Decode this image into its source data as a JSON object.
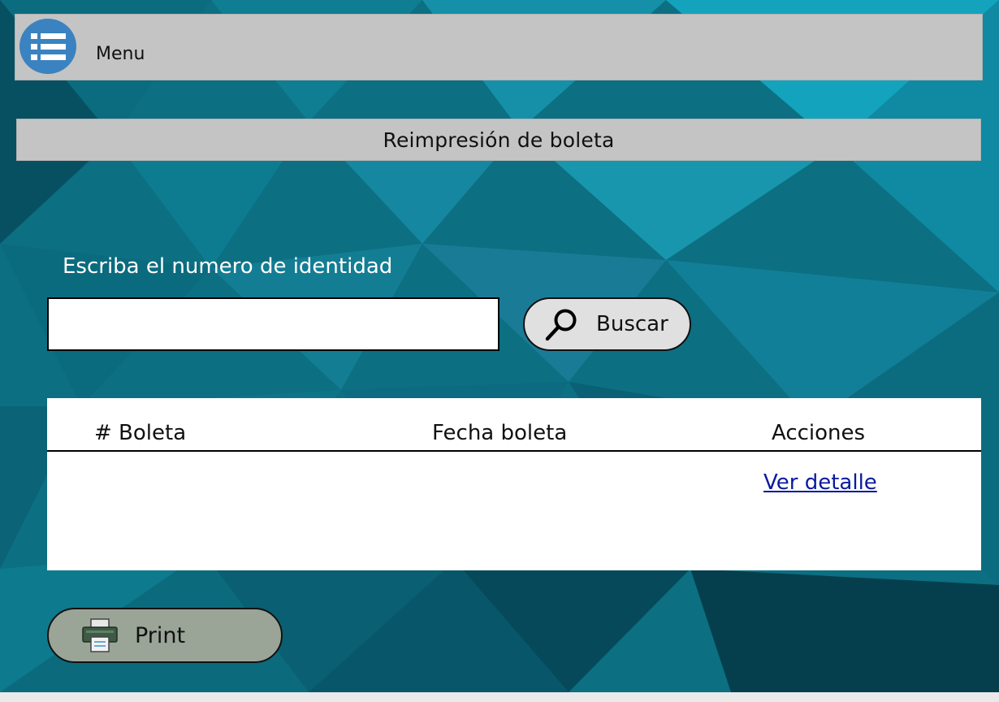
{
  "colors": {
    "panel_gray": "#c4c4c4",
    "menu_icon_blue": "#3a83c0",
    "link_blue": "#0a1a9e",
    "print_button_green": "#9aa597",
    "background_teal": "#0c6f82"
  },
  "header": {
    "menu_label": "Menu",
    "menu_icon": "list-menu-icon"
  },
  "page": {
    "title": "Reimpresión de boleta"
  },
  "search": {
    "label": "Escriba el numero de identidad",
    "value": "",
    "placeholder": "",
    "button_label": "Buscar",
    "button_icon": "search-icon"
  },
  "table": {
    "columns": [
      "# Boleta",
      "Fecha boleta",
      "Acciones"
    ],
    "rows": [
      {
        "boleta": "",
        "fecha": "",
        "accion": "Ver detalle"
      }
    ]
  },
  "print": {
    "button_label": "Print",
    "button_icon": "printer-icon"
  }
}
